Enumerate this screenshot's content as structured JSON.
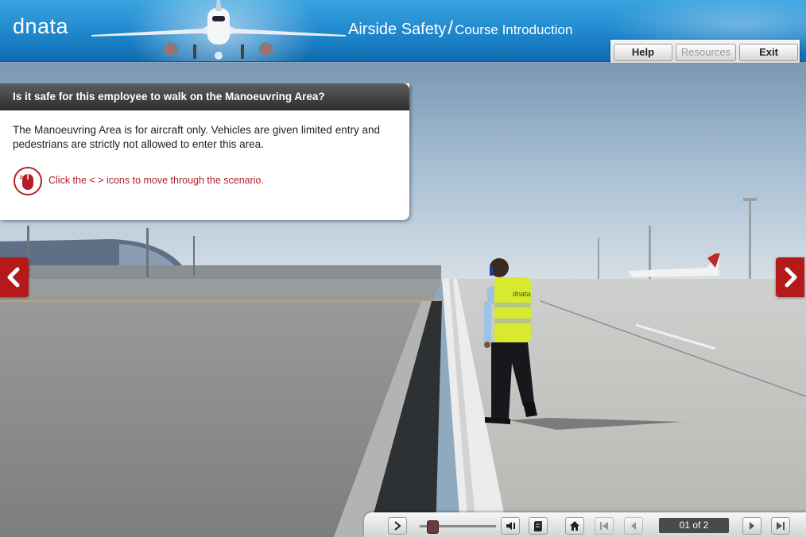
{
  "header": {
    "logo": "dnata",
    "title": "Airside Safety",
    "subtitle": "Course Introduction"
  },
  "top_buttons": {
    "help": "Help",
    "resources": "Resources",
    "exit": "Exit"
  },
  "panel": {
    "question": "Is it safe for this employee to walk on the Manoeuvring Area?",
    "body": "The Manoeuvring Area is for aircraft only. Vehicles are given limited entry and pedestrians are strictly not allowed to enter this area.",
    "hint": "Click the < > icons to move through the scenario."
  },
  "scene": {
    "vest_text": "dnata"
  },
  "nav": {
    "page_counter": "01 of 2",
    "progress": 0.1
  },
  "colors": {
    "header_blue": "#1e86cc",
    "accent_red": "#b51a1a",
    "hint_red": "#b32025"
  },
  "icons": {
    "prev_scene": "chevron-left-icon",
    "next_scene": "chevron-right-icon",
    "hint": "mouse-icon"
  }
}
